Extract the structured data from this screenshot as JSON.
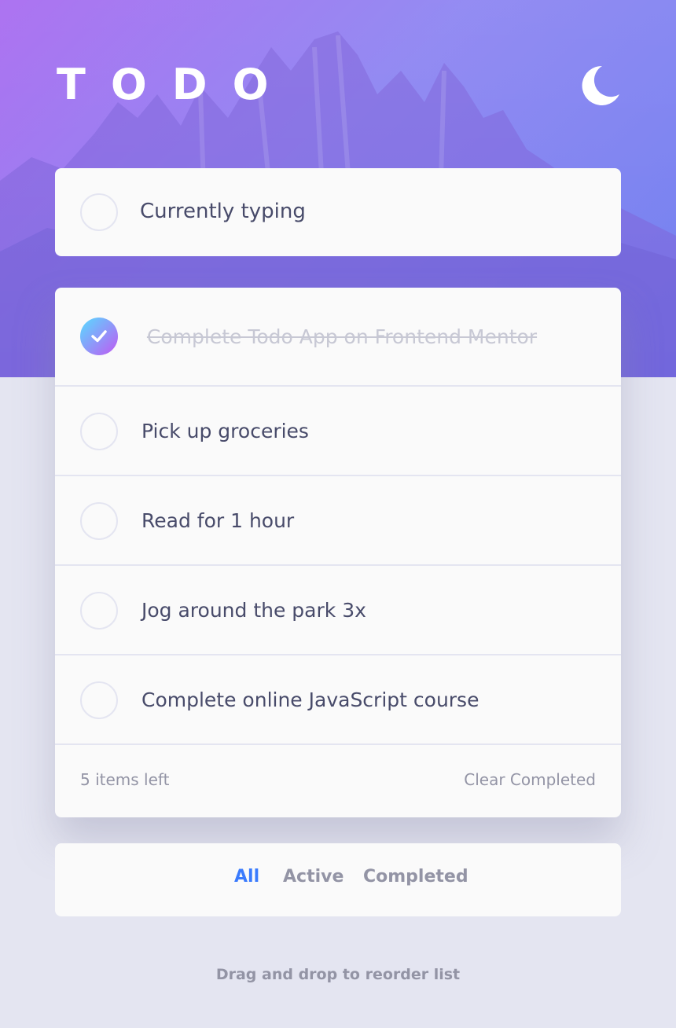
{
  "header": {
    "title": "TODO",
    "theme_icon": "moon-icon"
  },
  "new_todo": {
    "value": "Currently typing"
  },
  "todos": [
    {
      "text": "Complete Todo App on Frontend Mentor",
      "completed": true
    },
    {
      "text": "Pick up groceries",
      "completed": false
    },
    {
      "text": "Read for 1 hour",
      "completed": false
    },
    {
      "text": "Jog around the park 3x",
      "completed": false
    },
    {
      "text": "Complete online JavaScript course",
      "completed": false
    }
  ],
  "footer": {
    "items_left": "5 items left",
    "clear_label": "Clear Completed"
  },
  "filters": {
    "all": "All",
    "active": "Active",
    "completed": "Completed",
    "selected": "All"
  },
  "hint": "Drag and drop to reorder list",
  "colors": {
    "accent": "#3a7bfd",
    "check_gradient_start": "#57ddff",
    "check_gradient_end": "#c058f3",
    "background": "#e4e5f1",
    "card": "#fafafa",
    "text": "#484b6a",
    "muted": "#9394a5"
  }
}
